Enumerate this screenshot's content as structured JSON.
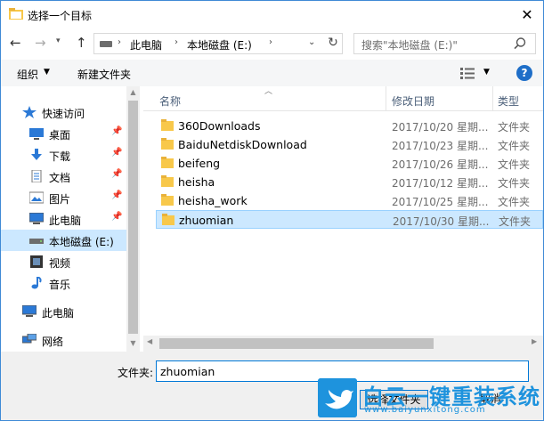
{
  "window": {
    "title": "选择一个目标",
    "close_glyph": "✕"
  },
  "address": {
    "segments": [
      "此电脑",
      "本地磁盘 (E:)"
    ],
    "search_placeholder": "搜索\"本地磁盘 (E:)\""
  },
  "toolbar": {
    "organize_label": "组织",
    "new_folder_label": "新建文件夹",
    "help_label": "?"
  },
  "sidebar": {
    "items": [
      {
        "label": "快速访问",
        "icon": "star-icon"
      },
      {
        "label": "桌面",
        "icon": "desktop-icon",
        "pinned": true
      },
      {
        "label": "下载",
        "icon": "download-icon",
        "pinned": true
      },
      {
        "label": "文档",
        "icon": "document-icon",
        "pinned": true
      },
      {
        "label": "图片",
        "icon": "picture-icon",
        "pinned": true
      },
      {
        "label": "此电脑",
        "icon": "computer-icon",
        "pinned": true
      },
      {
        "label": "本地磁盘 (E:)",
        "icon": "drive-icon",
        "selected": true
      },
      {
        "label": "视频",
        "icon": "video-icon"
      },
      {
        "label": "音乐",
        "icon": "music-icon"
      },
      {
        "label": "此电脑",
        "icon": "computer-icon"
      },
      {
        "label": "网络",
        "icon": "network-icon"
      }
    ]
  },
  "list": {
    "columns": [
      "名称",
      "修改日期",
      "类型"
    ],
    "rows": [
      {
        "name": "360Downloads",
        "date": "2017/10/20 星期...",
        "type": "文件夹"
      },
      {
        "name": "BaiduNetdiskDownload",
        "date": "2017/10/23 星期...",
        "type": "文件夹"
      },
      {
        "name": "beifeng",
        "date": "2017/10/26 星期...",
        "type": "文件夹"
      },
      {
        "name": "heisha",
        "date": "2017/10/12 星期...",
        "type": "文件夹"
      },
      {
        "name": "heisha_work",
        "date": "2017/10/25 星期...",
        "type": "文件夹"
      },
      {
        "name": "zhuomian",
        "date": "2017/10/30 星期...",
        "type": "文件夹",
        "selected": true
      }
    ]
  },
  "bottom": {
    "folder_label": "文件夹:",
    "folder_value": "zhuomian",
    "ok_label": "选择文件夹",
    "cancel_label": "取消"
  },
  "watermark": {
    "title": "白云一键重装系统",
    "url": "www.baiyunxitong.com"
  },
  "colors": {
    "accent": "#0078d7",
    "selection": "#cce8ff",
    "folder": "#f8c84a",
    "watermark": "#1e93dd"
  }
}
